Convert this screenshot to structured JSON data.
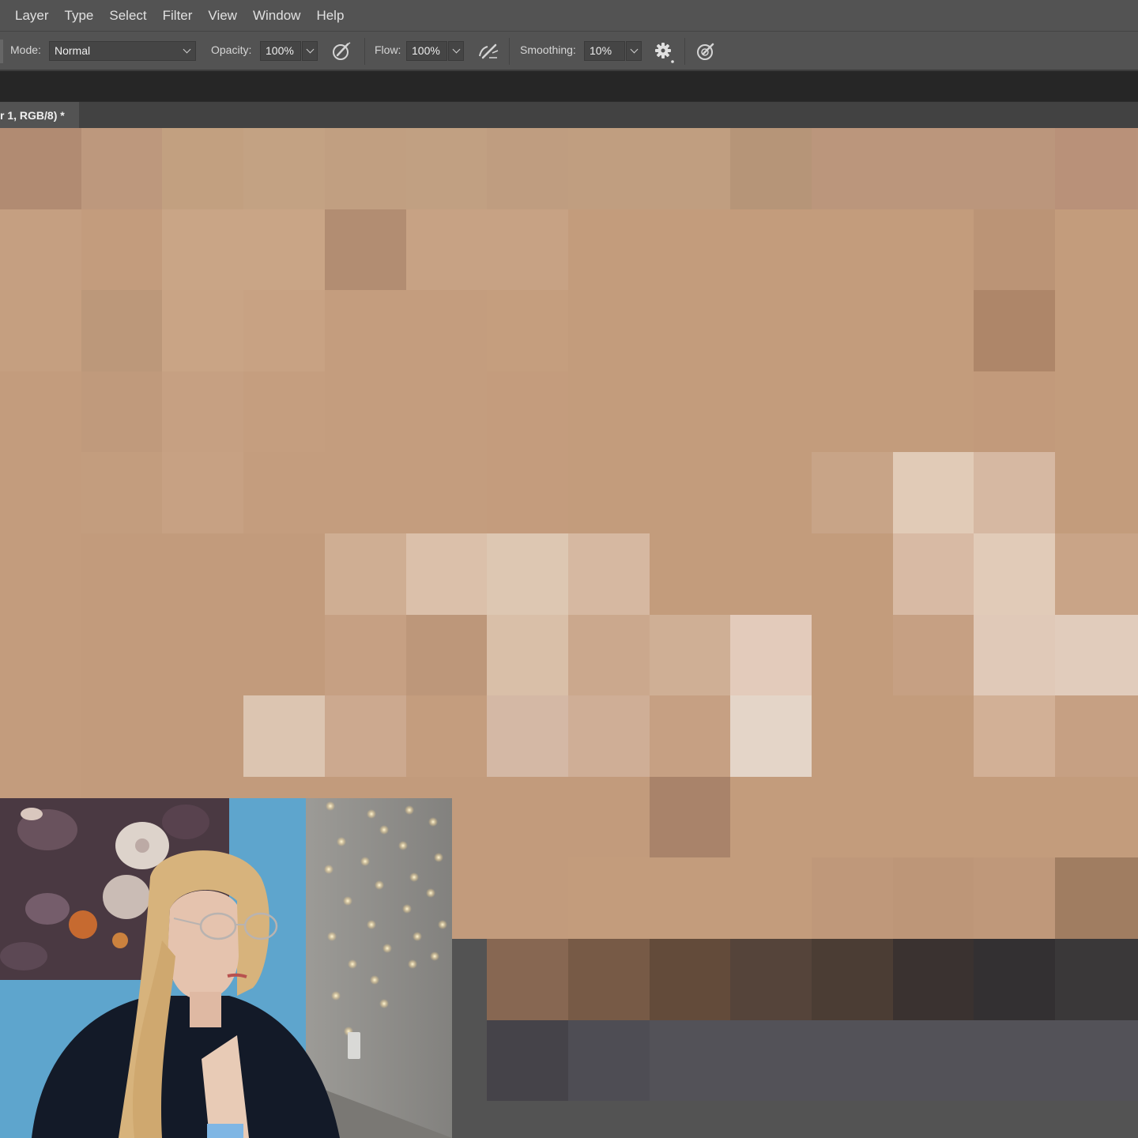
{
  "menu": [
    "Layer",
    "Type",
    "Select",
    "Filter",
    "View",
    "Window",
    "Help"
  ],
  "options": {
    "mode_label": "Mode:",
    "mode_value": "Normal",
    "opacity_label": "Opacity:",
    "opacity_value": "100%",
    "flow_label": "Flow:",
    "flow_value": "100%",
    "smoothing_label": "Smoothing:",
    "smoothing_value": "10%"
  },
  "document": {
    "tab_title": "r 1, RGB/8) *"
  },
  "canvas": {
    "description_colors": {
      "base": "#c29a7b"
    },
    "pixel_rows": [
      [
        "#b18b72",
        "#bd987d",
        "#c2a080",
        "#c3a283",
        "#c19f81",
        "#c1a082",
        "#bf9d80",
        "#c09e80",
        "#c09e80",
        "#b69578",
        "#bb967c",
        "#bb967c",
        "#bb967c",
        "#b99179",
        "#ba937a"
      ],
      [
        "#c59f81",
        "#c39c7d",
        "#c9a586",
        "#c9a586",
        "#b28d72",
        "#c7a284",
        "#c7a284",
        "#c39c7c",
        "#c39c7c",
        "#c39c7c",
        "#c39c7c",
        "#c39c7c",
        "#bb9476",
        "#c39c7c",
        "#c39c7c"
      ],
      [
        "#c59f80",
        "#bc987a",
        "#c9a485",
        "#c8a283",
        "#c49d7e",
        "#c49d7e",
        "#c59e7e",
        "#c39c7c",
        "#c39c7c",
        "#c39c7c",
        "#c39c7c",
        "#c39c7c",
        "#ae8669",
        "#c39c7c",
        "#c39c7c"
      ],
      [
        "#c39c7d",
        "#c09a7c",
        "#c6a082",
        "#c59e7f",
        "#c49d7e",
        "#c49d7e",
        "#c49c7d",
        "#c39c7c",
        "#c39c7c",
        "#c39c7c",
        "#c39c7c",
        "#c39c7c",
        "#c29a7b",
        "#c39c7c",
        "#c39c7c"
      ],
      [
        "#c39c7d",
        "#c39d7e",
        "#c7a183",
        "#c49d7e",
        "#c49d7e",
        "#c49d7e",
        "#c49c7d",
        "#c39c7c",
        "#c39c7c",
        "#c39c7c",
        "#c8a487",
        "#e1cbb7",
        "#d6b8a2",
        "#c39c7c",
        "#c39c7c"
      ],
      [
        "#c39c7d",
        "#c29b7c",
        "#c29b7c",
        "#c29b7c",
        "#cfae93",
        "#dbc0aa",
        "#ddc7b2",
        "#d6b8a1",
        "#c39c7c",
        "#c39c7c",
        "#c39c7c",
        "#d8baa4",
        "#e1cbb8",
        "#c9a487",
        "#c9a487"
      ],
      [
        "#c39c7d",
        "#c29b7c",
        "#c29b7c",
        "#c29b7c",
        "#c6a083",
        "#bd977a",
        "#d9bfa8",
        "#cba88d",
        "#cfaf95",
        "#e3cbbb",
        "#c39c7c",
        "#c6a083",
        "#e0c9b8",
        "#e1ccbc",
        "#e1ccbc"
      ],
      [
        "#c39c7d",
        "#c29b7c",
        "#c29b7c",
        "#dcc5b1",
        "#cca98f",
        "#c49d7e",
        "#d4b8a5",
        "#cfae96",
        "#c6a083",
        "#e4d5c8",
        "#c39c7c",
        "#c39c7c",
        "#d2b096",
        "#c6a083",
        "#c6a083"
      ],
      [
        "#c39c7d",
        "#c29b7c",
        "#c29b7c",
        "#c29b7c",
        "#c29b7c",
        "#c29b7c",
        "#c29b7c",
        "#c29b7c",
        "#a9836a",
        "#c39c7c",
        "#c39c7c",
        "#c39c7c",
        "#c39c7c",
        "#c39c7c",
        "#c39c7c"
      ],
      [
        "#c39c7d",
        "#c29b7c",
        "#c29b7c",
        "#c29b7c",
        "#c29b7c",
        "#c29b7c",
        "#c29b7c",
        "#c39c7c",
        "#c39c7c",
        "#c39c7c",
        "#bf987a",
        "#bd9678",
        "#bf987a",
        "#a07d61",
        "#a07d61"
      ],
      [
        "#535353",
        "#535353",
        "#535353",
        "#535353",
        "#535353",
        "#535353",
        "#876752",
        "#775a46",
        "#634b3a",
        "#55443a",
        "#4b3d34",
        "#3a3230",
        "#333032",
        "#3a3839",
        "#3a3839"
      ],
      [
        "#535353",
        "#535353",
        "#535353",
        "#535353",
        "#535353",
        "#535353",
        "#454349",
        "#4e4d54",
        "#535258",
        "#535258",
        "#535258",
        "#535258",
        "#535258",
        "#535258",
        "#535258"
      ],
      [
        "#535353",
        "#535353",
        "#535353",
        "#535353",
        "#535353",
        "#535353",
        "#535353",
        "#535353",
        "#535353",
        "#535353",
        "#535353",
        "#535353",
        "#535353",
        "#535353",
        "#535353"
      ]
    ]
  }
}
